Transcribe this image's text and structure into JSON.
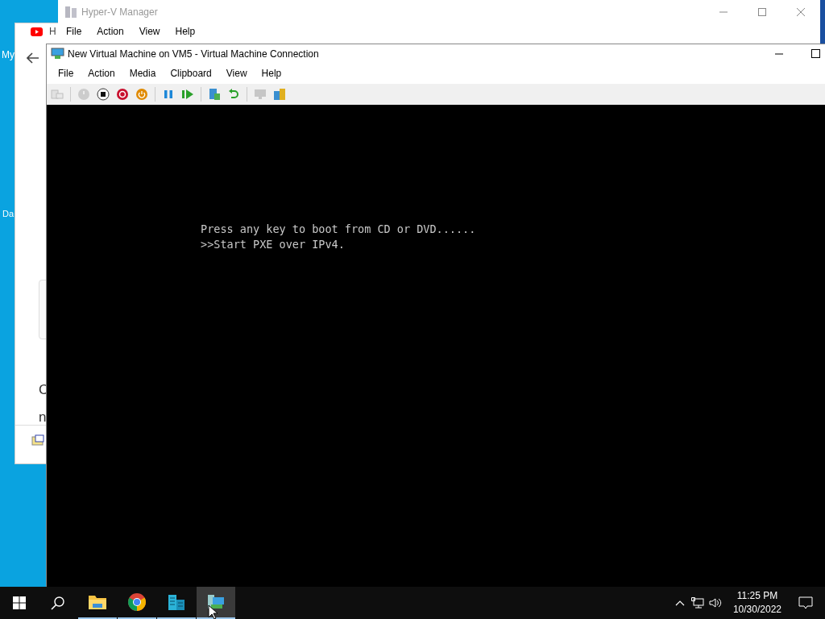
{
  "desktop": {
    "labels": [
      "My",
      "Da"
    ]
  },
  "browser": {
    "tab_text": "H",
    "texts": [
      "C",
      "n"
    ]
  },
  "manager": {
    "title": "Hyper-V Manager",
    "active": false,
    "menu": [
      "File",
      "Action",
      "View",
      "Help"
    ]
  },
  "vm": {
    "title": "New Virtual Machine on VM5 - Virtual Machine Connection",
    "active": true,
    "menu": [
      "File",
      "Action",
      "Media",
      "Clipboard",
      "View",
      "Help"
    ],
    "toolbar": [
      {
        "kind": "ctrl-alt-del",
        "disabled": true
      },
      {
        "kind": "start",
        "disabled": true
      },
      {
        "kind": "turn-off",
        "disabled": false
      },
      {
        "kind": "shut-down",
        "disabled": false
      },
      {
        "kind": "save",
        "disabled": false
      },
      {
        "kind": "pause",
        "disabled": false
      },
      {
        "kind": "resume",
        "disabled": false
      },
      {
        "kind": "checkpoint",
        "disabled": false
      },
      {
        "kind": "revert",
        "disabled": false
      },
      {
        "kind": "enhanced",
        "disabled": true
      },
      {
        "kind": "share",
        "disabled": false
      }
    ],
    "console": [
      "Press any key to boot from CD or DVD......",
      ">>Start PXE over IPv4."
    ]
  },
  "taskbar": {
    "apps": [
      {
        "kind": "explorer",
        "running": true,
        "selected": false
      },
      {
        "kind": "chrome",
        "running": true,
        "selected": false
      },
      {
        "kind": "server-manager",
        "running": true,
        "selected": false
      },
      {
        "kind": "hyperv",
        "running": true,
        "selected": true
      }
    ],
    "time": "11:25 PM",
    "date": "10/30/2022"
  }
}
